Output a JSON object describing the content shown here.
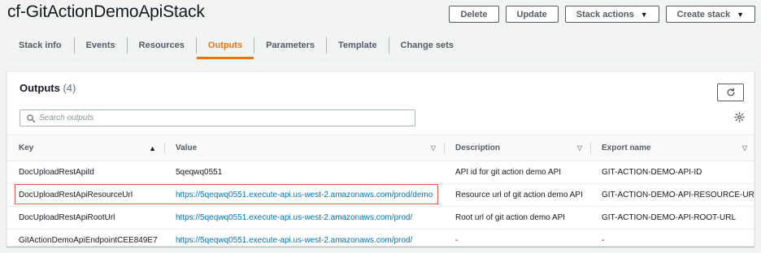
{
  "page": {
    "title": "cf-GitActionDemoApiStack"
  },
  "actions": {
    "delete_label": "Delete",
    "update_label": "Update",
    "stack_actions_label": "Stack actions",
    "create_stack_label": "Create stack"
  },
  "tabs": [
    {
      "label": "Stack info",
      "active": false
    },
    {
      "label": "Events",
      "active": false
    },
    {
      "label": "Resources",
      "active": false
    },
    {
      "label": "Outputs",
      "active": true
    },
    {
      "label": "Parameters",
      "active": false
    },
    {
      "label": "Template",
      "active": false
    },
    {
      "label": "Change sets",
      "active": false
    }
  ],
  "outputs": {
    "title": "Outputs",
    "count": "(4)",
    "search_placeholder": "Search outputs",
    "columns": {
      "key": "Key",
      "value": "Value",
      "description": "Description",
      "export_name": "Export name"
    },
    "rows": [
      {
        "key": "DocUploadRestApiId",
        "value": "5qeqwq0551",
        "value_is_link": false,
        "description": "API id for git action demo API",
        "export_name": "GIT-ACTION-DEMO-API-ID"
      },
      {
        "key": "DocUploadRestApiResourceUrl",
        "value": "https://5qeqwq0551.execute-api.us-west-2.amazonaws.com/prod/demo",
        "value_is_link": true,
        "description": "Resource url of git action demo API",
        "export_name": "GIT-ACTION-DEMO-API-RESOURCE-URL",
        "highlighted": true
      },
      {
        "key": "DocUploadRestApiRootUrl",
        "value": "https://5qeqwq0551.execute-api.us-west-2.amazonaws.com/prod/",
        "value_is_link": true,
        "description": "Root url of git action demo API",
        "export_name": "GIT-ACTION-DEMO-API-ROOT-URL"
      },
      {
        "key": "GitActionDemoApiEndpointCEE849E7",
        "value": "https://5qeqwq0551.execute-api.us-west-2.amazonaws.com/prod/",
        "value_is_link": true,
        "description": "-",
        "export_name": "-"
      }
    ]
  },
  "icons": {
    "refresh": "refresh-icon",
    "search": "search-icon",
    "settings": "gear-icon",
    "sort_asc": "sort-ascending-icon",
    "sort": "sort-icon",
    "dropdown": "caret-down-icon"
  },
  "colors": {
    "accent_tab": "#ec7211",
    "link": "#0073bb",
    "highlight_border": "#e8564a"
  }
}
